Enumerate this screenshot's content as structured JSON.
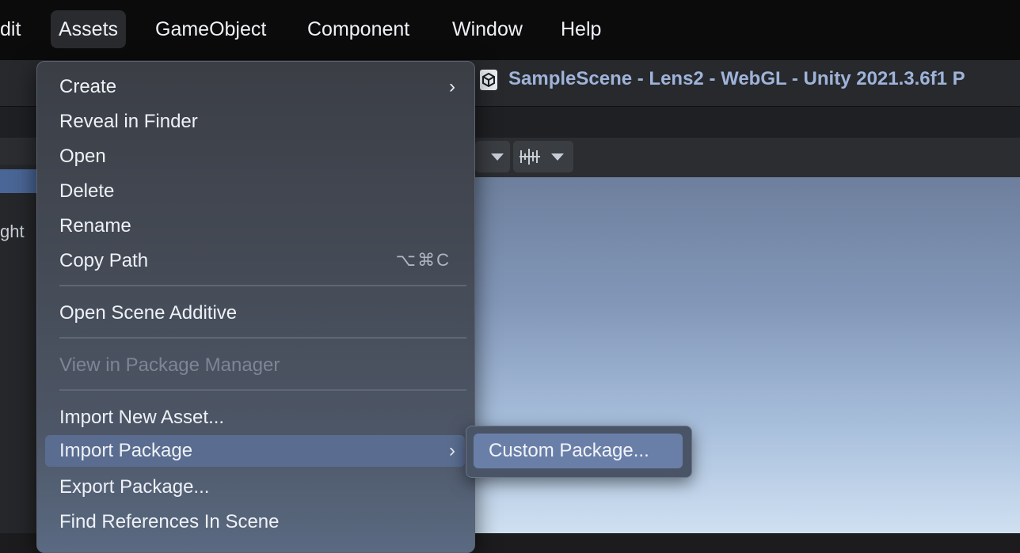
{
  "menubar": {
    "items": [
      "Edit",
      "Assets",
      "GameObject",
      "Component",
      "Window",
      "Help"
    ],
    "visible_edit_fragment": "dit",
    "active": "Assets"
  },
  "window": {
    "title": "SampleScene - Lens2 - WebGL - Unity 2021.3.6f1 P",
    "left_panel_fragment": "ght"
  },
  "assets_menu": {
    "items": [
      {
        "label": "Create",
        "submenu": true
      },
      {
        "label": "Reveal in Finder"
      },
      {
        "label": "Open"
      },
      {
        "label": "Delete"
      },
      {
        "label": "Rename"
      },
      {
        "label": "Copy Path",
        "shortcut": "⌥⌘C"
      },
      {
        "label": "Open Scene Additive"
      },
      {
        "label": "View in Package Manager",
        "disabled": true
      },
      {
        "label": "Import New Asset..."
      },
      {
        "label": "Import Package",
        "submenu": true,
        "highlighted": true
      },
      {
        "label": "Export Package..."
      },
      {
        "label": "Find References In Scene"
      }
    ],
    "chevron": "›"
  },
  "import_package_submenu": {
    "items": [
      {
        "label": "Custom Package...",
        "highlighted": true
      }
    ]
  },
  "colors": {
    "menubar_bg": "#0b0b0c",
    "menu_highlight": "#5a6d90",
    "submenu_highlight": "#6a7fa8",
    "window_title": "#9fb3d9"
  }
}
